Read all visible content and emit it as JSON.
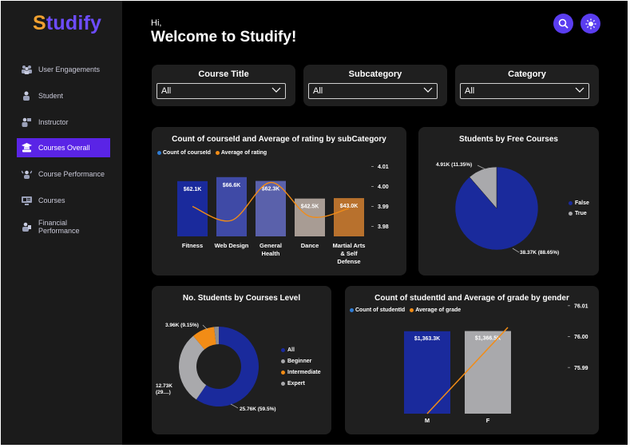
{
  "brand": {
    "logo_first": "S",
    "logo_rest": "tudify"
  },
  "sidebar": {
    "items": [
      {
        "label": "User Engagements",
        "icon": "users-icon",
        "active": false
      },
      {
        "label": "Student",
        "icon": "student-icon",
        "active": false
      },
      {
        "label": "Instructor",
        "icon": "instructor-icon",
        "active": false
      },
      {
        "label": "Courses Overall",
        "icon": "courses-overall-icon",
        "active": true
      },
      {
        "label": "Course Performance",
        "icon": "performance-icon",
        "active": false
      },
      {
        "label": "Courses",
        "icon": "courses-icon",
        "active": false
      },
      {
        "label": "Financial Performance",
        "icon": "finance-icon",
        "active": false
      }
    ]
  },
  "header": {
    "greeting": "Hi,",
    "welcome": "Welcome to Studify!",
    "search_icon": "search-icon",
    "theme_icon": "theme-toggle-icon"
  },
  "filters": [
    {
      "title": "Course Title",
      "value": "All"
    },
    {
      "title": "Subcategory",
      "value": "All"
    },
    {
      "title": "Category",
      "value": "All"
    }
  ],
  "colors": {
    "navy": "#1a2a9c",
    "blue_bar": "#2433a6",
    "orange": "#f28c16",
    "gray": "#a9a9ac",
    "accent": "#5a24e6"
  },
  "chart_data": [
    {
      "type": "bar",
      "title": "Count of courseId and Average of rating by subCategory",
      "legend": [
        {
          "name": "Count of courseId",
          "color": "#2f7dd6"
        },
        {
          "name": "Average of rating",
          "color": "#f28c16"
        }
      ],
      "categories": [
        "Fitness",
        "Web Design",
        "General Health",
        "Dance",
        "Martial Arts & Self Defense"
      ],
      "series": [
        {
          "name": "Count of courseId",
          "values": [
            62.1,
            66.6,
            62.3,
            42.5,
            43.0
          ],
          "labels": [
            "$62.1K",
            "$66.6K",
            "$62.3K",
            "$42.5K",
            "$43.0K"
          ],
          "colors": [
            "#1a2a9c",
            "#3f4aa6",
            "#5a61ab",
            "#a89c94",
            "#b8712d"
          ]
        },
        {
          "name": "Average of rating",
          "values": [
            3.99,
            3.983,
            4.002,
            3.985,
            3.989
          ]
        }
      ],
      "y_right_ticks": [
        "4.01",
        "4.00",
        "3.99",
        "3.98"
      ],
      "ylim": [
        0,
        70
      ],
      "y2lim": [
        3.975,
        4.015
      ]
    },
    {
      "type": "pie",
      "title": "Students by Free Courses",
      "slices": [
        {
          "name": "False",
          "value": 38.37,
          "label": "38.37K (88.65%)",
          "color": "#1a2a9c"
        },
        {
          "name": "True",
          "value": 4.91,
          "label": "4.91K (11.35%)",
          "color": "#a9a9ac"
        }
      ]
    },
    {
      "type": "pie",
      "title": "No. Students by Courses Level",
      "legend": [
        {
          "name": "All",
          "color": "#1a2a9c"
        },
        {
          "name": "Beginner",
          "color": "#a9a9ac"
        },
        {
          "name": "Intermediate",
          "color": "#f28c16"
        },
        {
          "name": "Expert",
          "color": "#a9a9ac"
        }
      ],
      "slices": [
        {
          "name": "All",
          "value": 25.76,
          "label": "25.76K (59.5%)",
          "color": "#1a2a9c"
        },
        {
          "name": "Beginner",
          "value": 12.73,
          "label": "12.73K (29....)",
          "color": "#a9a9ac"
        },
        {
          "name": "Intermediate",
          "value": 3.96,
          "label": "3.96K (9.15%)",
          "color": "#f28c16"
        },
        {
          "name": "Expert",
          "value": 0.82,
          "label": "",
          "color": "#8f8f93"
        }
      ]
    },
    {
      "type": "bar",
      "title": "Count of studentId and Average of grade by gender",
      "legend": [
        {
          "name": "Count of studentId",
          "color": "#2f7dd6"
        },
        {
          "name": "Average of grade",
          "color": "#f28c16"
        }
      ],
      "categories": [
        "M",
        "F"
      ],
      "series": [
        {
          "name": "Count of studentId",
          "values": [
            1363.3,
            1366.5
          ],
          "labels": [
            "$1,363.3K",
            "$1,366.5K"
          ],
          "colors": [
            "#1a2a9c",
            "#a9a9ac"
          ]
        },
        {
          "name": "Average of grade",
          "values": [
            75.985,
            76.005
          ]
        }
      ],
      "y_right_ticks": [
        "76.01",
        "76.00",
        "75.99"
      ],
      "ylim": [
        0,
        1400
      ],
      "y2lim": [
        75.98,
        76.02
      ]
    }
  ]
}
